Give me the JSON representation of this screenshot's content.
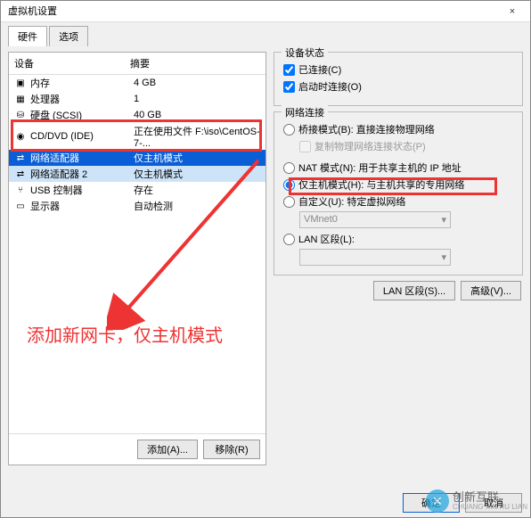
{
  "window": {
    "title": "虚拟机设置",
    "close": "×"
  },
  "tabs": {
    "hardware": "硬件",
    "options": "选项"
  },
  "columns": {
    "device": "设备",
    "summary": "摘要"
  },
  "devices": [
    {
      "icon": "▣",
      "name": "内存",
      "summary": "4 GB"
    },
    {
      "icon": "▦",
      "name": "处理器",
      "summary": "1"
    },
    {
      "icon": "⛁",
      "name": "硬盘 (SCSI)",
      "summary": "40 GB"
    },
    {
      "icon": "◉",
      "name": "CD/DVD (IDE)",
      "summary": "正在使用文件 F:\\iso\\CentOS-7-..."
    },
    {
      "icon": "⇄",
      "name": "网络适配器",
      "summary": "仅主机模式"
    },
    {
      "icon": "⇄",
      "name": "网络适配器 2",
      "summary": "仅主机模式"
    },
    {
      "icon": "⑂",
      "name": "USB 控制器",
      "summary": "存在"
    },
    {
      "icon": "▭",
      "name": "显示器",
      "summary": "自动检测"
    }
  ],
  "left_buttons": {
    "add": "添加(A)...",
    "remove": "移除(R)"
  },
  "device_status": {
    "title": "设备状态",
    "connected": "已连接(C)",
    "connect_on": "启动时连接(O)"
  },
  "net": {
    "title": "网络连接",
    "bridged": "桥接模式(B): 直接连接物理网络",
    "replicate": "复制物理网络连接状态(P)",
    "nat": "NAT 模式(N): 用于共享主机的 IP 地址",
    "hostonly": "仅主机模式(H): 与主机共享的专用网络",
    "custom": "自定义(U): 特定虚拟网络",
    "vmnet": "VMnet0",
    "lan": "LAN 区段(L):"
  },
  "right_buttons": {
    "lanseg": "LAN 区段(S)...",
    "advanced": "高级(V)..."
  },
  "footer": {
    "ok": "确定",
    "cancel": "取消"
  },
  "annotation": "添加新网卡，仅主机模式",
  "watermark": {
    "icon": "✕",
    "title": "创新互联",
    "sub": "CHUANG XIN HU LIAN"
  }
}
